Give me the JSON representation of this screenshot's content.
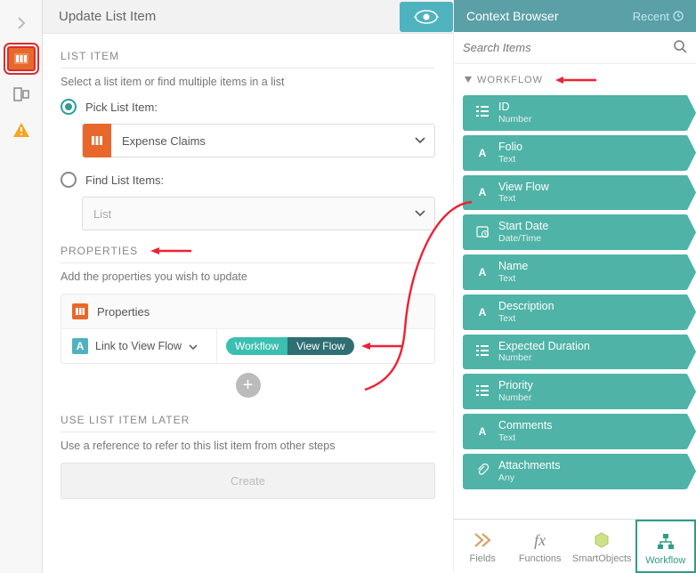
{
  "header": {
    "title": "Update List Item"
  },
  "sections": {
    "listItem": {
      "title": "LIST ITEM",
      "sub": "Select a list item or find multiple items in a list",
      "pickLabel": "Pick List Item:",
      "findLabel": "Find List Items:",
      "pickedValue": "Expense Claims",
      "findPlaceholder": "List"
    },
    "properties": {
      "title": "PROPERTIES",
      "sub": "Add the properties you wish to update",
      "boxHead": "Properties",
      "fieldLabel": "Link to View Flow",
      "pill1": "Workflow",
      "pill2": "View Flow"
    },
    "later": {
      "title": "USE LIST ITEM LATER",
      "sub": "Use a reference to refer to this list item from other steps",
      "createLabel": "Create"
    }
  },
  "context": {
    "title": "Context Browser",
    "recent": "Recent",
    "searchPlaceholder": "Search Items",
    "treeTitle": "WORKFLOW",
    "nodes": [
      {
        "icon": "list",
        "label": "ID",
        "type": "Number"
      },
      {
        "icon": "A",
        "label": "Folio",
        "type": "Text"
      },
      {
        "icon": "A",
        "label": "View Flow",
        "type": "Text"
      },
      {
        "icon": "clock",
        "label": "Start Date",
        "type": "Date/Time"
      },
      {
        "icon": "A",
        "label": "Name",
        "type": "Text"
      },
      {
        "icon": "A",
        "label": "Description",
        "type": "Text"
      },
      {
        "icon": "list",
        "label": "Expected Duration",
        "type": "Number"
      },
      {
        "icon": "list",
        "label": "Priority",
        "type": "Number"
      },
      {
        "icon": "A",
        "label": "Comments",
        "type": "Text"
      },
      {
        "icon": "attach",
        "label": "Attachments",
        "type": "Any"
      }
    ],
    "tabs": {
      "fields": "Fields",
      "functions": "Functions",
      "smartobjects": "SmartObjects",
      "workflow": "Workflow"
    }
  }
}
